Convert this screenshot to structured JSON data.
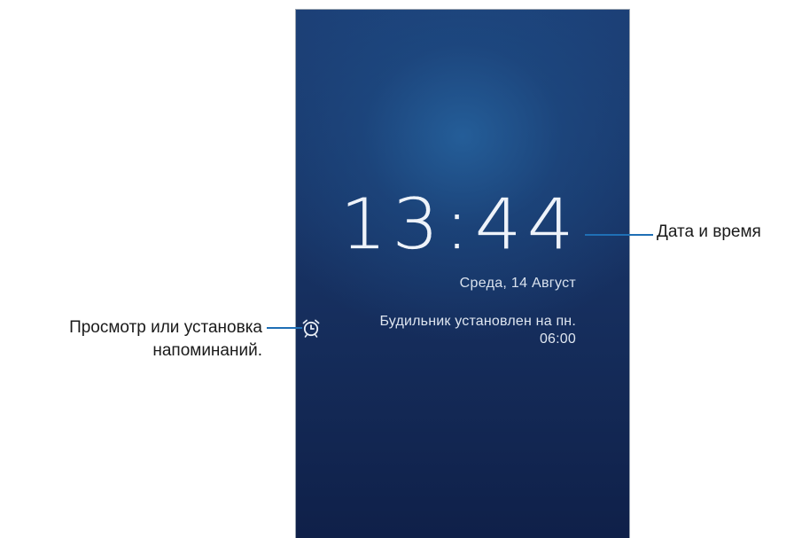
{
  "lockscreen": {
    "time": "13:44",
    "date": "Среда, 14 Август",
    "alarm_line1": "Будильник установлен на пн.",
    "alarm_line2": "06:00"
  },
  "annotations": {
    "date_time_label": "Дата и время",
    "reminders_line1": "Просмотр или установка",
    "reminders_line2": "напоминаний."
  },
  "icons": {
    "alarm": "alarm-clock-icon"
  },
  "colors": {
    "callout": "#1f6fb5",
    "screen_top": "#1c3f76",
    "screen_bottom": "#0f2049"
  }
}
